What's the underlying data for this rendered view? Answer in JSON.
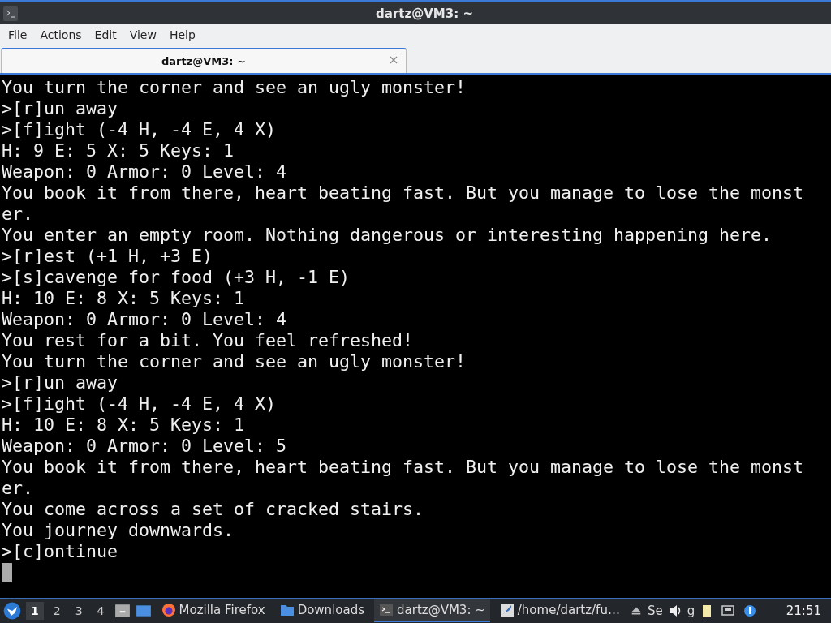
{
  "window": {
    "title": "dartz@VM3: ~"
  },
  "menu": [
    "File",
    "Actions",
    "Edit",
    "View",
    "Help"
  ],
  "tabs": [
    {
      "label": "dartz@VM3: ~",
      "selected": true
    }
  ],
  "terminal": {
    "lines": [
      "You turn the corner and see an ugly monster!",
      ">[r]un away",
      ">[f]ight (-4 H, -4 E, 4 X)",
      "H: 9 E: 5 X: 5 Keys: 1",
      "Weapon: 0 Armor: 0 Level: 4",
      "You book it from there, heart beating fast. But you manage to lose the monst",
      "er.",
      "You enter an empty room. Nothing dangerous or interesting happening here.",
      ">[r]est (+1 H, +3 E)",
      ">[s]cavenge for food (+3 H, -1 E)",
      "H: 10 E: 8 X: 5 Keys: 1",
      "Weapon: 0 Armor: 0 Level: 4",
      "You rest for a bit. You feel refreshed!",
      "You turn the corner and see an ugly monster!",
      ">[r]un away",
      ">[f]ight (-4 H, -4 E, 4 X)",
      "H: 10 E: 8 X: 5 Keys: 1",
      "Weapon: 0 Armor: 0 Level: 5",
      "You book it from there, heart beating fast. But you manage to lose the monst",
      "er.",
      "You come across a set of cracked stairs.",
      "You journey downwards.",
      ">[c]ontinue"
    ]
  },
  "taskbar": {
    "workspaces": [
      {
        "label": "1",
        "selected": true
      },
      {
        "label": "2",
        "selected": false
      },
      {
        "label": "3",
        "selected": false
      },
      {
        "label": "4",
        "selected": false
      }
    ],
    "tasks": [
      {
        "kind": "firefox",
        "label": "Mozilla Firefox",
        "selected": false
      },
      {
        "kind": "folder",
        "label": "Downloads",
        "selected": false
      },
      {
        "kind": "terminal",
        "label": "dartz@VM3: ~",
        "selected": true
      },
      {
        "kind": "editor",
        "label": "/home/dartz/fu…",
        "selected": false
      }
    ],
    "tray": [
      "Se",
      "g"
    ],
    "clock": "21:51"
  }
}
